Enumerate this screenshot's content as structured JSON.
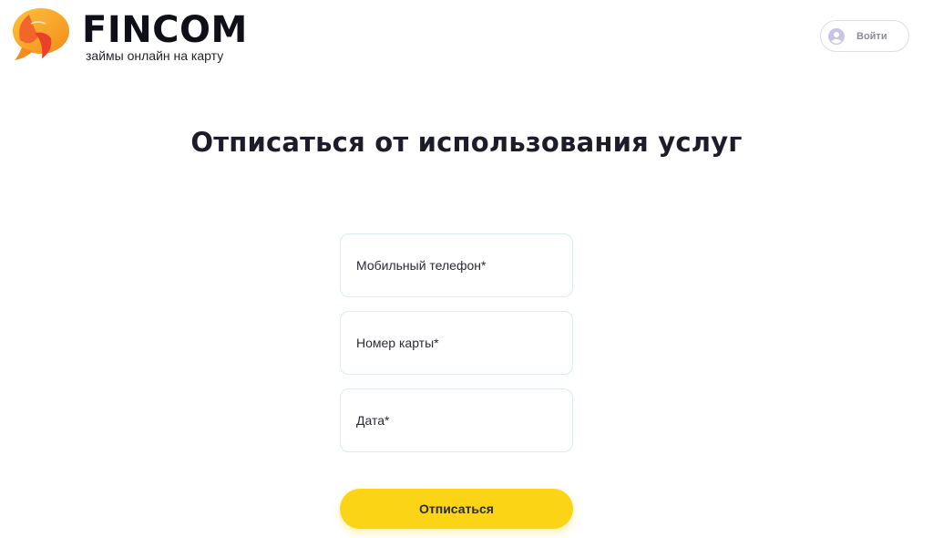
{
  "header": {
    "logo_name": "FINCOM",
    "logo_tagline": "займы онлайн на карту",
    "login_label": "Войти"
  },
  "page": {
    "title": "Отписаться от использования услуг"
  },
  "form": {
    "phone_placeholder": "Мобильный телефон*",
    "phone_value": "",
    "card_placeholder": "Номер карты*",
    "card_value": "",
    "date_placeholder": "Дата*",
    "date_value": "",
    "submit_label": "Отписаться"
  },
  "icons": {
    "logo": "speech-bubble-leaf-icon",
    "login": "user-circle-icon"
  },
  "colors": {
    "accent_yellow": "#fbd415",
    "logo_orange": "#f7931e",
    "logo_red": "#f0582a",
    "field_border": "#d9ecec",
    "login_icon": "#c9c4e6"
  }
}
